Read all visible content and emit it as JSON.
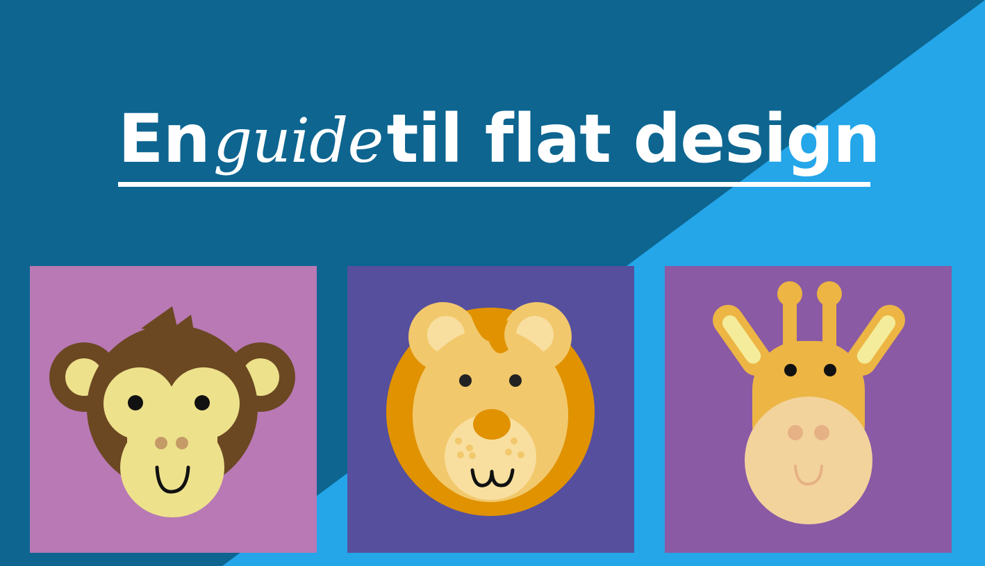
{
  "title": {
    "before": "En",
    "emphasis": "guide",
    "after": "til flat design"
  },
  "colors": {
    "background_dark": "#0d6590",
    "background_light": "#24a6e9",
    "title_text": "#ffffff",
    "monkey_card": "#b879b5",
    "lion_card": "#554f9e",
    "giraffe_card": "#8a5aa5"
  },
  "cards": [
    {
      "animal": "monkey",
      "icon": "monkey-icon"
    },
    {
      "animal": "lion",
      "icon": "lion-icon"
    },
    {
      "animal": "giraffe",
      "icon": "giraffe-icon"
    }
  ]
}
